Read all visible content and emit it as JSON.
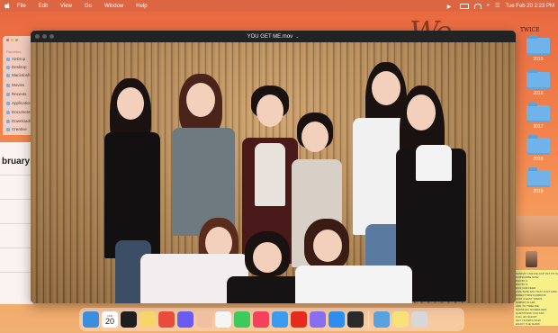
{
  "menubar": {
    "items": [
      "File",
      "Edit",
      "View",
      "Go",
      "Window",
      "Help"
    ],
    "clock": "Tue Feb 20 2:23 PM"
  },
  "wallpaper": {
    "script": "We",
    "tag": "TWICE"
  },
  "desktop_folders": [
    {
      "label": "2015"
    },
    {
      "label": "2016"
    },
    {
      "label": "2017"
    },
    {
      "label": "2018"
    },
    {
      "label": "2019"
    }
  ],
  "finder": {
    "section": "Favorites",
    "items": [
      "AirDrop",
      "Desktop",
      "Macintosh",
      "Movies",
      "Recents",
      "Applications",
      "Documents",
      "Downloads",
      "Creative"
    ]
  },
  "calendar": {
    "month": "bruary"
  },
  "notes": {
    "lines": [
      "SUNDAY LIVE RE-CAP YET TO SAY",
      "SUBSCRIBE NOW",
      "PHOTO 2",
      "PHOTO 3",
      "FAN CAM FEED",
      "LIVE TAPE FAN THAT JUST LIKE",
      "DIRECT MINI FANBOOK",
      "JUST 4 EASY STEPS",
      "SUBMIT IN ART",
      "ADD TO TIMELINE",
      "SHOW ALL SCHEDULES",
      "QUESTIONS YOU ASK",
      "FULL HD SHOOT",
      "GET TICKETS NOW",
      "ENJOY THE SHOW"
    ]
  },
  "video": {
    "title": "YOU GET ME.mov",
    "chevron": "⌄"
  },
  "dock": {
    "calendar_month": "FEB",
    "calendar_day": "20",
    "apps": [
      {
        "name": "finder",
        "color": "#3b8de0"
      },
      {
        "name": "calendar",
        "color": "#ffffff"
      },
      {
        "name": "capcut",
        "color": "#1e1e1e"
      },
      {
        "name": "notes",
        "color": "#f5d66a"
      },
      {
        "name": "chrome",
        "color": "#e94b3c"
      },
      {
        "name": "arc",
        "color": "#6a5cf0"
      },
      {
        "name": "photos",
        "color": "#f1c0a0"
      },
      {
        "name": "word",
        "color": "#f5f5f5"
      },
      {
        "name": "facetime",
        "color": "#3ccb5a"
      },
      {
        "name": "music",
        "color": "#f4425a"
      },
      {
        "name": "safari",
        "color": "#3a9bef"
      },
      {
        "name": "youtube",
        "color": "#e82a1e"
      },
      {
        "name": "siri",
        "color": "#8a6ef0"
      },
      {
        "name": "appstore",
        "color": "#2f8df0"
      },
      {
        "name": "camera",
        "color": "#2a2a2a"
      }
    ],
    "trail": [
      {
        "name": "folder",
        "color": "#5aa2dd"
      },
      {
        "name": "stickies",
        "color": "#f7e27a"
      },
      {
        "name": "trash",
        "color": "#d7d7d7"
      }
    ]
  }
}
